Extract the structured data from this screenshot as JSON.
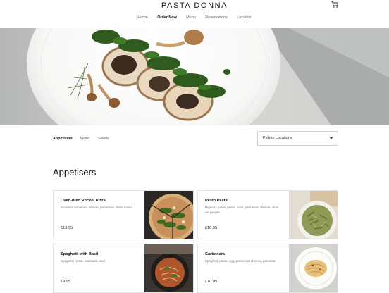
{
  "brand": {
    "name": "PASTA DONNA"
  },
  "nav": {
    "items": [
      "Home",
      "Order Now",
      "Menu",
      "Reservations",
      "Location"
    ],
    "active_index": 1
  },
  "filters": {
    "tabs": [
      "Appetisers",
      "Mains",
      "Salads"
    ],
    "active_index": 0
  },
  "location_select": {
    "selected": "Pickup Locations"
  },
  "section": {
    "title": "Appetisers"
  },
  "menu_items": [
    {
      "name": "Oven-fired Rocket Pizza",
      "description": "Sundried tomatoes, shaved parmesan, fresh rocket",
      "price": "£13.95",
      "photo_icon": "pizza-photo"
    },
    {
      "name": "Pesto Pasta",
      "description": "Rigatoni pasta, pesto, basil, parmesan cheese, olive oil, pepper",
      "price": "£10.95",
      "photo_icon": "pesto-pasta-photo"
    },
    {
      "name": "Spaghetti with Basil",
      "description": "Spaghetti pasta, marinara, basil",
      "price": "£9.95",
      "photo_icon": "spaghetti-photo"
    },
    {
      "name": "Carbonara",
      "description": "Spaghetti pasta, egg, parmesan cheese, pancetta",
      "price": "£10.95",
      "photo_icon": "carbonara-photo"
    }
  ],
  "colors": {
    "accent": "#111111",
    "muted_text": "#777777",
    "border": "#e5e5e5",
    "herb_green": "#2f5b1f"
  }
}
